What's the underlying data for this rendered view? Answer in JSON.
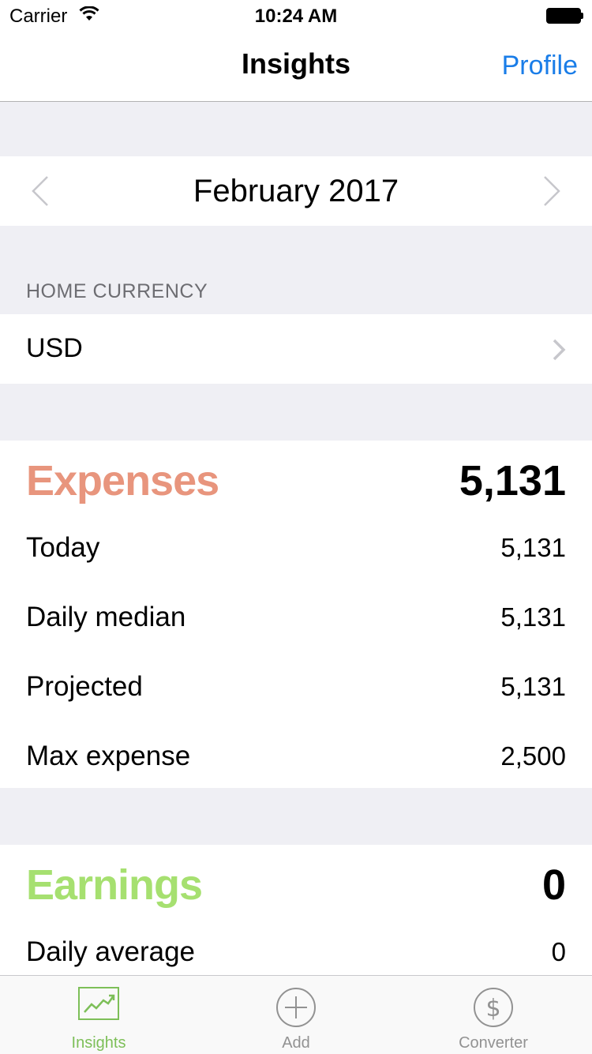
{
  "status_bar": {
    "carrier": "Carrier",
    "time": "10:24 AM"
  },
  "nav": {
    "title": "Insights",
    "right_button": "Profile"
  },
  "month_selector": {
    "label": "February 2017"
  },
  "currency": {
    "section_header": "HOME CURRENCY",
    "value": "USD"
  },
  "expenses": {
    "title": "Expenses",
    "total": "5,131",
    "rows": [
      {
        "label": "Today",
        "value": "5,131"
      },
      {
        "label": "Daily median",
        "value": "5,131"
      },
      {
        "label": "Projected",
        "value": "5,131"
      },
      {
        "label": "Max expense",
        "value": "2,500"
      }
    ]
  },
  "earnings": {
    "title": "Earnings",
    "total": "0",
    "rows": [
      {
        "label": "Daily average",
        "value": "0"
      }
    ]
  },
  "tab_bar": {
    "tabs": [
      {
        "label": "Insights",
        "icon": "chart-icon",
        "active": true
      },
      {
        "label": "Add",
        "icon": "plus-circle-icon",
        "active": false
      },
      {
        "label": "Converter",
        "icon": "dollar-circle-icon",
        "active": false
      }
    ]
  },
  "colors": {
    "accent": "#1a7de8",
    "expenses": "#e8957d",
    "earnings": "#a6e070",
    "active_tab": "#7dbf58"
  }
}
